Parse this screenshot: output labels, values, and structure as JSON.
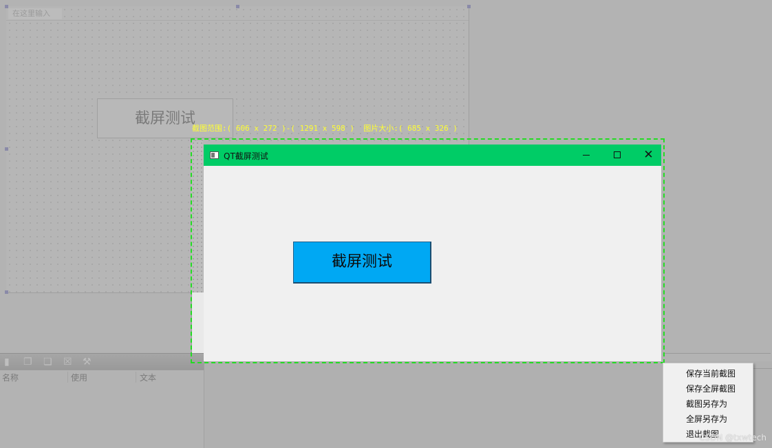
{
  "designer": {
    "menu_placeholder": "在这里输入",
    "form_button_label": "截屏测试",
    "panel_headers": [
      "名称",
      "使用",
      "文本"
    ]
  },
  "capture_info": "截图范围:( 606 x 272 )-( 1291 x 598 )  图片大小:( 685 x 326 )",
  "window": {
    "title": "QT截屏测试",
    "button_label": "截屏测试",
    "minimize_icon": "minimize-icon",
    "maximize_icon": "maximize-icon",
    "close_icon": "close-icon",
    "title_bar_color": "#00cc66",
    "button_color": "#00a8f3"
  },
  "selection_color": "#22dd22",
  "context_menu": {
    "items": [
      "保存当前截图",
      "保存全屏截图",
      "截图另存为",
      "全屏另存为",
      "退出截图"
    ]
  },
  "watermark": "CSDN @txwtech"
}
